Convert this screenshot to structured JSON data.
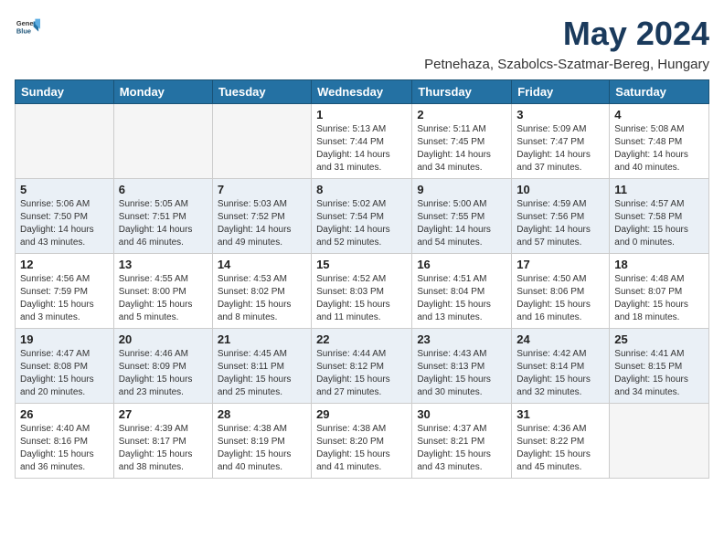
{
  "header": {
    "logo_general": "General",
    "logo_blue": "Blue",
    "month_title": "May 2024",
    "location": "Petnehaza, Szabolcs-Szatmar-Bereg, Hungary"
  },
  "days_of_week": [
    "Sunday",
    "Monday",
    "Tuesday",
    "Wednesday",
    "Thursday",
    "Friday",
    "Saturday"
  ],
  "weeks": [
    {
      "days": [
        {
          "num": "",
          "empty": true
        },
        {
          "num": "",
          "empty": true
        },
        {
          "num": "",
          "empty": true
        },
        {
          "num": "1",
          "info": "Sunrise: 5:13 AM\nSunset: 7:44 PM\nDaylight: 14 hours\nand 31 minutes."
        },
        {
          "num": "2",
          "info": "Sunrise: 5:11 AM\nSunset: 7:45 PM\nDaylight: 14 hours\nand 34 minutes."
        },
        {
          "num": "3",
          "info": "Sunrise: 5:09 AM\nSunset: 7:47 PM\nDaylight: 14 hours\nand 37 minutes."
        },
        {
          "num": "4",
          "info": "Sunrise: 5:08 AM\nSunset: 7:48 PM\nDaylight: 14 hours\nand 40 minutes."
        }
      ]
    },
    {
      "days": [
        {
          "num": "5",
          "info": "Sunrise: 5:06 AM\nSunset: 7:50 PM\nDaylight: 14 hours\nand 43 minutes."
        },
        {
          "num": "6",
          "info": "Sunrise: 5:05 AM\nSunset: 7:51 PM\nDaylight: 14 hours\nand 46 minutes."
        },
        {
          "num": "7",
          "info": "Sunrise: 5:03 AM\nSunset: 7:52 PM\nDaylight: 14 hours\nand 49 minutes."
        },
        {
          "num": "8",
          "info": "Sunrise: 5:02 AM\nSunset: 7:54 PM\nDaylight: 14 hours\nand 52 minutes."
        },
        {
          "num": "9",
          "info": "Sunrise: 5:00 AM\nSunset: 7:55 PM\nDaylight: 14 hours\nand 54 minutes."
        },
        {
          "num": "10",
          "info": "Sunrise: 4:59 AM\nSunset: 7:56 PM\nDaylight: 14 hours\nand 57 minutes."
        },
        {
          "num": "11",
          "info": "Sunrise: 4:57 AM\nSunset: 7:58 PM\nDaylight: 15 hours\nand 0 minutes."
        }
      ]
    },
    {
      "days": [
        {
          "num": "12",
          "info": "Sunrise: 4:56 AM\nSunset: 7:59 PM\nDaylight: 15 hours\nand 3 minutes."
        },
        {
          "num": "13",
          "info": "Sunrise: 4:55 AM\nSunset: 8:00 PM\nDaylight: 15 hours\nand 5 minutes."
        },
        {
          "num": "14",
          "info": "Sunrise: 4:53 AM\nSunset: 8:02 PM\nDaylight: 15 hours\nand 8 minutes."
        },
        {
          "num": "15",
          "info": "Sunrise: 4:52 AM\nSunset: 8:03 PM\nDaylight: 15 hours\nand 11 minutes."
        },
        {
          "num": "16",
          "info": "Sunrise: 4:51 AM\nSunset: 8:04 PM\nDaylight: 15 hours\nand 13 minutes."
        },
        {
          "num": "17",
          "info": "Sunrise: 4:50 AM\nSunset: 8:06 PM\nDaylight: 15 hours\nand 16 minutes."
        },
        {
          "num": "18",
          "info": "Sunrise: 4:48 AM\nSunset: 8:07 PM\nDaylight: 15 hours\nand 18 minutes."
        }
      ]
    },
    {
      "days": [
        {
          "num": "19",
          "info": "Sunrise: 4:47 AM\nSunset: 8:08 PM\nDaylight: 15 hours\nand 20 minutes."
        },
        {
          "num": "20",
          "info": "Sunrise: 4:46 AM\nSunset: 8:09 PM\nDaylight: 15 hours\nand 23 minutes."
        },
        {
          "num": "21",
          "info": "Sunrise: 4:45 AM\nSunset: 8:11 PM\nDaylight: 15 hours\nand 25 minutes."
        },
        {
          "num": "22",
          "info": "Sunrise: 4:44 AM\nSunset: 8:12 PM\nDaylight: 15 hours\nand 27 minutes."
        },
        {
          "num": "23",
          "info": "Sunrise: 4:43 AM\nSunset: 8:13 PM\nDaylight: 15 hours\nand 30 minutes."
        },
        {
          "num": "24",
          "info": "Sunrise: 4:42 AM\nSunset: 8:14 PM\nDaylight: 15 hours\nand 32 minutes."
        },
        {
          "num": "25",
          "info": "Sunrise: 4:41 AM\nSunset: 8:15 PM\nDaylight: 15 hours\nand 34 minutes."
        }
      ]
    },
    {
      "days": [
        {
          "num": "26",
          "info": "Sunrise: 4:40 AM\nSunset: 8:16 PM\nDaylight: 15 hours\nand 36 minutes."
        },
        {
          "num": "27",
          "info": "Sunrise: 4:39 AM\nSunset: 8:17 PM\nDaylight: 15 hours\nand 38 minutes."
        },
        {
          "num": "28",
          "info": "Sunrise: 4:38 AM\nSunset: 8:19 PM\nDaylight: 15 hours\nand 40 minutes."
        },
        {
          "num": "29",
          "info": "Sunrise: 4:38 AM\nSunset: 8:20 PM\nDaylight: 15 hours\nand 41 minutes."
        },
        {
          "num": "30",
          "info": "Sunrise: 4:37 AM\nSunset: 8:21 PM\nDaylight: 15 hours\nand 43 minutes."
        },
        {
          "num": "31",
          "info": "Sunrise: 4:36 AM\nSunset: 8:22 PM\nDaylight: 15 hours\nand 45 minutes."
        },
        {
          "num": "",
          "empty": true
        }
      ]
    }
  ]
}
